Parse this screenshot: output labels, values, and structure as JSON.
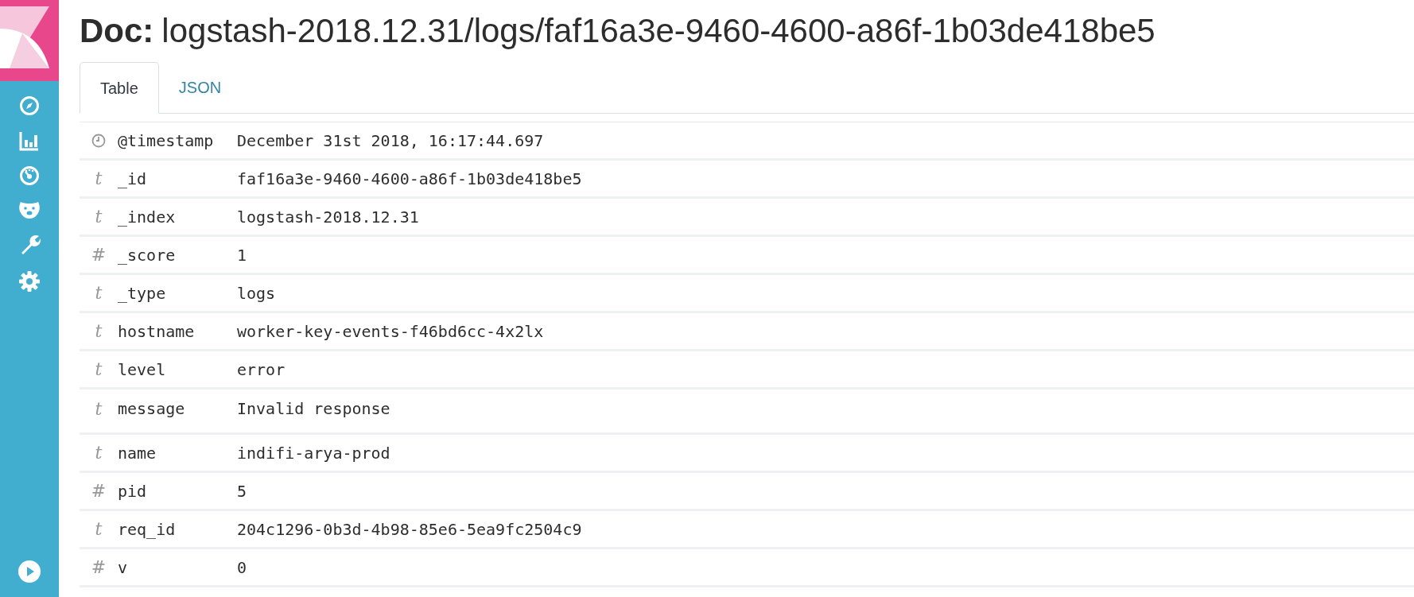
{
  "nav": [
    {
      "kind": "compass"
    },
    {
      "kind": "chart"
    },
    {
      "kind": "gauge"
    },
    {
      "kind": "bear"
    },
    {
      "kind": "wrench"
    },
    {
      "kind": "gear"
    }
  ],
  "title": {
    "label": "Doc:",
    "path": "logstash-2018.12.31/logs/faf16a3e-9460-4600-a86f-1b03de418be5"
  },
  "tabs": [
    {
      "label": "Table",
      "selected": true
    },
    {
      "label": "JSON",
      "selected": false
    }
  ],
  "fields": [
    {
      "kind": "date",
      "name": "@timestamp",
      "value": "December 31st 2018, 16:17:44.697"
    },
    {
      "kind": "string",
      "symbol": "t",
      "name": "_id",
      "value": "faf16a3e-9460-4600-a86f-1b03de418be5"
    },
    {
      "kind": "string",
      "symbol": "t",
      "name": "_index",
      "value": "logstash-2018.12.31"
    },
    {
      "kind": "number",
      "symbol": "#",
      "name": "_score",
      "value": "1"
    },
    {
      "kind": "string",
      "symbol": "t",
      "name": "_type",
      "value": "logs"
    },
    {
      "kind": "string",
      "symbol": "t",
      "name": "hostname",
      "value": "worker-key-events-f46bd6cc-4x2lx"
    },
    {
      "kind": "string",
      "symbol": "t",
      "name": "level",
      "value": "error"
    },
    {
      "kind": "string",
      "symbol": "t",
      "name": "message",
      "value": "Invalid response",
      "tall": true
    },
    {
      "kind": "string",
      "symbol": "t",
      "name": "name",
      "value": "indifi-arya-prod"
    },
    {
      "kind": "number",
      "symbol": "#",
      "name": "pid",
      "value": "5"
    },
    {
      "kind": "string",
      "symbol": "t",
      "name": "req_id",
      "value": "204c1296-0b3d-4b98-85e6-5ea9fc2504c9"
    },
    {
      "kind": "number",
      "symbol": "#",
      "name": "v",
      "value": "0"
    }
  ]
}
